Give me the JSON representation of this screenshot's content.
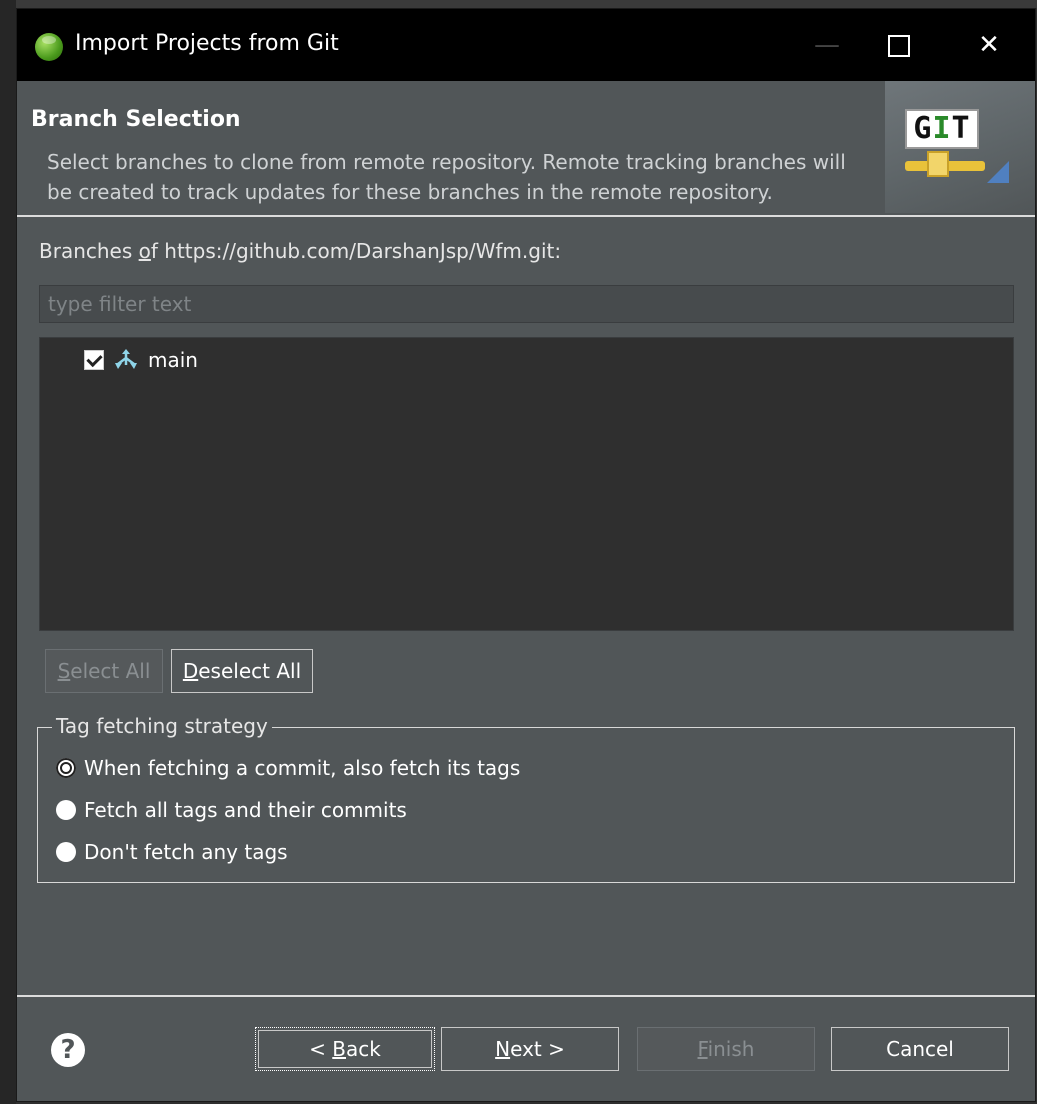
{
  "window": {
    "title": "Import Projects from Git",
    "controls": [
      "minimize",
      "maximize",
      "close"
    ]
  },
  "header": {
    "title": "Branch Selection",
    "description": "Select branches to clone from remote repository. Remote tracking branches will be created to track updates for these branches in the remote repository.",
    "banner_icon": "git-logo-icon"
  },
  "branches": {
    "label_prefix": "Branches ",
    "label_mnemonic": "o",
    "label_rest": "f https://github.com/DarshanJsp/Wfm.git:",
    "filter_placeholder": "type filter text",
    "items": [
      {
        "name": "main",
        "checked": true,
        "icon": "branch-icon"
      }
    ]
  },
  "selection_buttons": {
    "select_all_mnemonic": "S",
    "select_all_rest": "elect All",
    "select_all_enabled": false,
    "deselect_all_mnemonic": "D",
    "deselect_all_rest": "eselect All",
    "deselect_all_enabled": true
  },
  "tag_fetching": {
    "legend": "Tag fetching strategy",
    "options": [
      {
        "label": "When fetching a commit, also fetch its tags",
        "selected": true
      },
      {
        "label": "Fetch all tags and their commits",
        "selected": false
      },
      {
        "label": "Don't fetch any tags",
        "selected": false
      }
    ]
  },
  "footer": {
    "help_icon": "help-icon",
    "help_glyph": "?",
    "back_prefix": "< ",
    "back_mnemonic": "B",
    "back_rest": "ack",
    "next_mnemonic": "N",
    "next_rest": "ext >",
    "finish_mnemonic": "F",
    "finish_rest": "inish",
    "finish_enabled": false,
    "cancel_label": "Cancel"
  }
}
